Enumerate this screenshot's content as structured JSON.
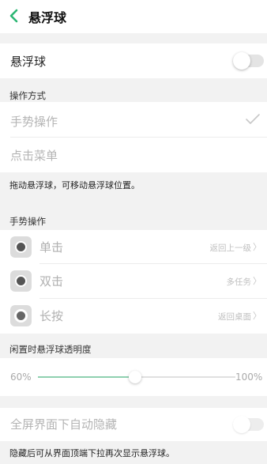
{
  "header": {
    "title": "悬浮球"
  },
  "floating_ball": {
    "label": "悬浮球",
    "enabled": false
  },
  "operation_mode": {
    "section_label": "操作方式",
    "options": [
      {
        "label": "手势操作",
        "selected": true
      },
      {
        "label": "点击菜单",
        "selected": false
      }
    ],
    "note": "拖动悬浮球，可移动悬浮球位置。"
  },
  "gestures": {
    "section_label": "手势操作",
    "items": [
      {
        "label": "单击",
        "action": "返回上一级",
        "icon": "tap-icon"
      },
      {
        "label": "双击",
        "action": "多任务",
        "icon": "double-tap-icon"
      },
      {
        "label": "长按",
        "action": "返回桌面",
        "icon": "long-press-icon"
      }
    ]
  },
  "idle_opacity": {
    "section_label": "闲置时悬浮球透明度",
    "min_label": "60%",
    "max_label": "100%",
    "value_fraction": 0.49
  },
  "autohide": {
    "label": "全屏界面下自动隐藏",
    "enabled": false,
    "note": "隐藏后可从界面顶端下拉再次显示悬浮球。"
  },
  "colors": {
    "accent": "#2bb673",
    "slider_fill": "#8fd0b0"
  }
}
